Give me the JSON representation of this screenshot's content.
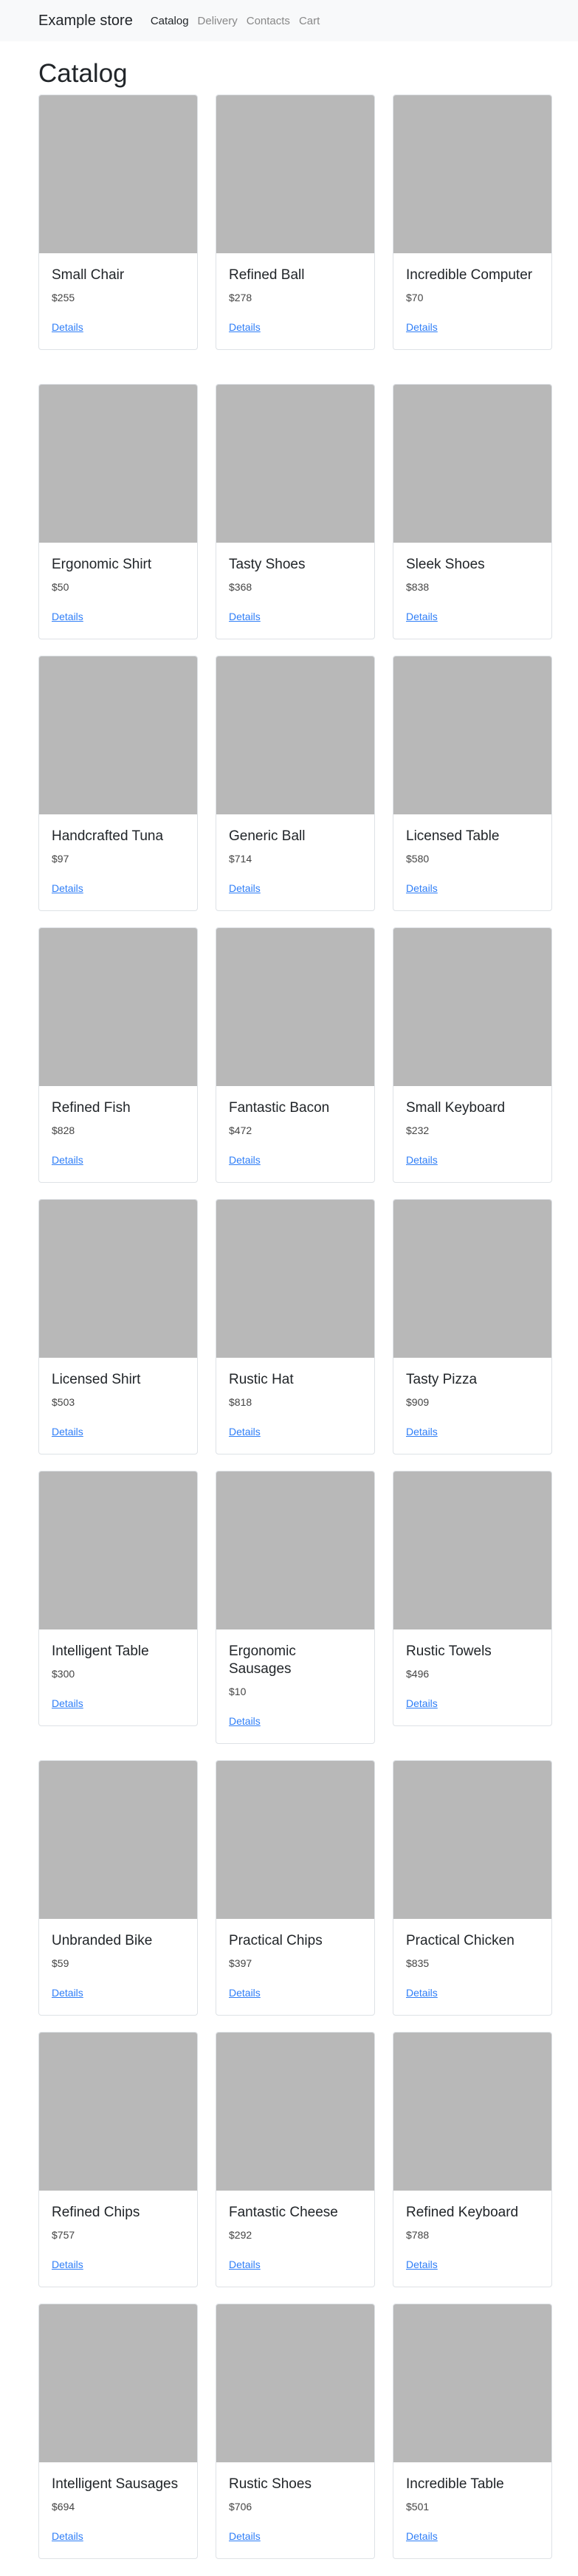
{
  "nav": {
    "brand": "Example store",
    "links": [
      {
        "label": "Catalog",
        "active": true
      },
      {
        "label": "Delivery",
        "active": false
      },
      {
        "label": "Contacts",
        "active": false
      },
      {
        "label": "Cart",
        "active": false
      }
    ]
  },
  "page_title": "Catalog",
  "link_label": "Details",
  "products": [
    {
      "name": "Small Chair",
      "price": "$255"
    },
    {
      "name": "Refined Ball",
      "price": "$278"
    },
    {
      "name": "Incredible Computer",
      "price": "$70"
    },
    {
      "name": "Ergonomic Shirt",
      "price": "$50"
    },
    {
      "name": "Tasty Shoes",
      "price": "$368"
    },
    {
      "name": "Sleek Shoes",
      "price": "$838"
    },
    {
      "name": "Handcrafted Tuna",
      "price": "$97"
    },
    {
      "name": "Generic Ball",
      "price": "$714"
    },
    {
      "name": "Licensed Table",
      "price": "$580"
    },
    {
      "name": "Refined Fish",
      "price": "$828"
    },
    {
      "name": "Fantastic Bacon",
      "price": "$472"
    },
    {
      "name": "Small Keyboard",
      "price": "$232"
    },
    {
      "name": "Licensed Shirt",
      "price": "$503"
    },
    {
      "name": "Rustic Hat",
      "price": "$818"
    },
    {
      "name": "Tasty Pizza",
      "price": "$909"
    },
    {
      "name": "Intelligent Table",
      "price": "$300"
    },
    {
      "name": "Ergonomic Sausages",
      "price": "$10"
    },
    {
      "name": "Rustic Towels",
      "price": "$496"
    },
    {
      "name": "Unbranded Bike",
      "price": "$59"
    },
    {
      "name": "Practical Chips",
      "price": "$397"
    },
    {
      "name": "Practical Chicken",
      "price": "$835"
    },
    {
      "name": "Refined Chips",
      "price": "$757"
    },
    {
      "name": "Fantastic Cheese",
      "price": "$292"
    },
    {
      "name": "Refined Keyboard",
      "price": "$788"
    },
    {
      "name": "Intelligent Sausages",
      "price": "$694"
    },
    {
      "name": "Rustic Shoes",
      "price": "$706"
    },
    {
      "name": "Incredible Table",
      "price": "$501"
    }
  ]
}
